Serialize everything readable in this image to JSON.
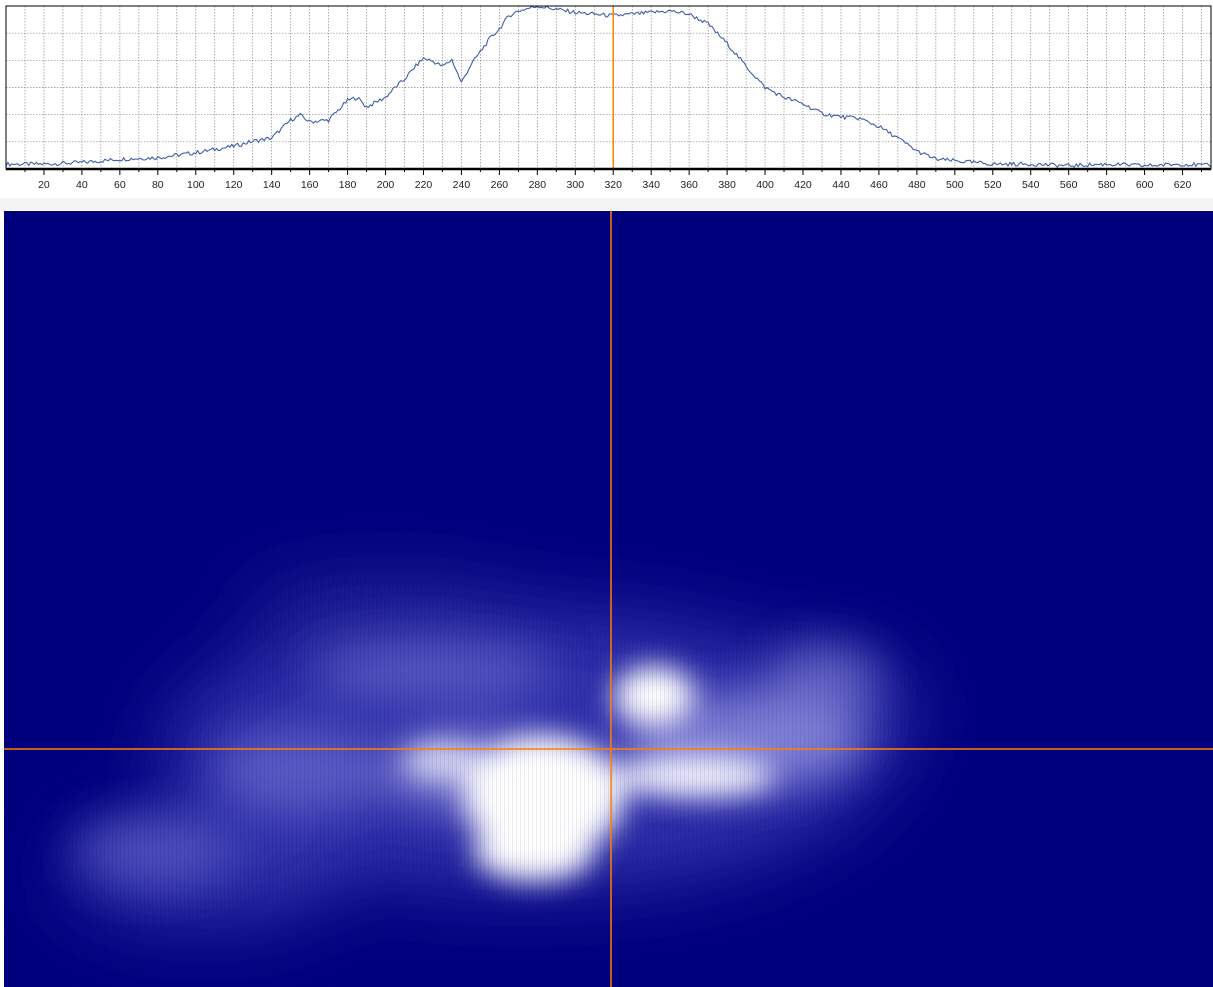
{
  "colors": {
    "plot_background": "#ffffff",
    "grid": "#8a8a8a",
    "profile_line": "#3f5fa8",
    "cursor": "#ff7f00",
    "beam_background": "#00007f",
    "beam_peak": "#ffffff"
  },
  "cursor": {
    "x": 320
  },
  "chart_data": {
    "type": "line",
    "x_ticks": [
      20,
      40,
      60,
      80,
      100,
      120,
      140,
      160,
      180,
      200,
      220,
      240,
      260,
      280,
      300,
      320,
      340,
      360,
      380,
      400,
      420,
      440,
      460,
      480,
      500,
      520,
      540,
      560,
      580,
      600,
      620
    ],
    "xlim": [
      0,
      635
    ],
    "ylim": [
      0,
      1
    ],
    "grid": true,
    "series": [
      {
        "x": [
          0,
          20,
          40,
          60,
          80,
          100,
          120,
          130,
          140,
          150,
          155,
          160,
          170,
          175,
          180,
          185,
          190,
          200,
          205,
          210,
          215,
          220,
          225,
          230,
          235,
          240,
          245,
          250,
          255,
          260,
          265,
          270,
          280,
          290,
          300,
          310,
          320,
          330,
          340,
          350,
          360,
          370,
          380,
          390,
          400,
          410,
          420,
          430,
          440,
          450,
          460,
          470,
          480,
          490,
          500,
          510,
          520,
          540,
          560,
          580,
          600,
          620,
          635
        ],
        "y": [
          0.03,
          0.03,
          0.04,
          0.06,
          0.07,
          0.1,
          0.14,
          0.17,
          0.19,
          0.3,
          0.33,
          0.29,
          0.3,
          0.36,
          0.42,
          0.44,
          0.38,
          0.44,
          0.5,
          0.55,
          0.62,
          0.68,
          0.66,
          0.63,
          0.67,
          0.53,
          0.64,
          0.72,
          0.8,
          0.86,
          0.94,
          0.97,
          1.0,
          0.98,
          0.96,
          0.95,
          0.94,
          0.95,
          0.96,
          0.97,
          0.95,
          0.89,
          0.77,
          0.63,
          0.5,
          0.44,
          0.4,
          0.34,
          0.32,
          0.31,
          0.26,
          0.19,
          0.11,
          0.06,
          0.05,
          0.04,
          0.03,
          0.03,
          0.02,
          0.03,
          0.02,
          0.03,
          0.02
        ]
      }
    ]
  }
}
